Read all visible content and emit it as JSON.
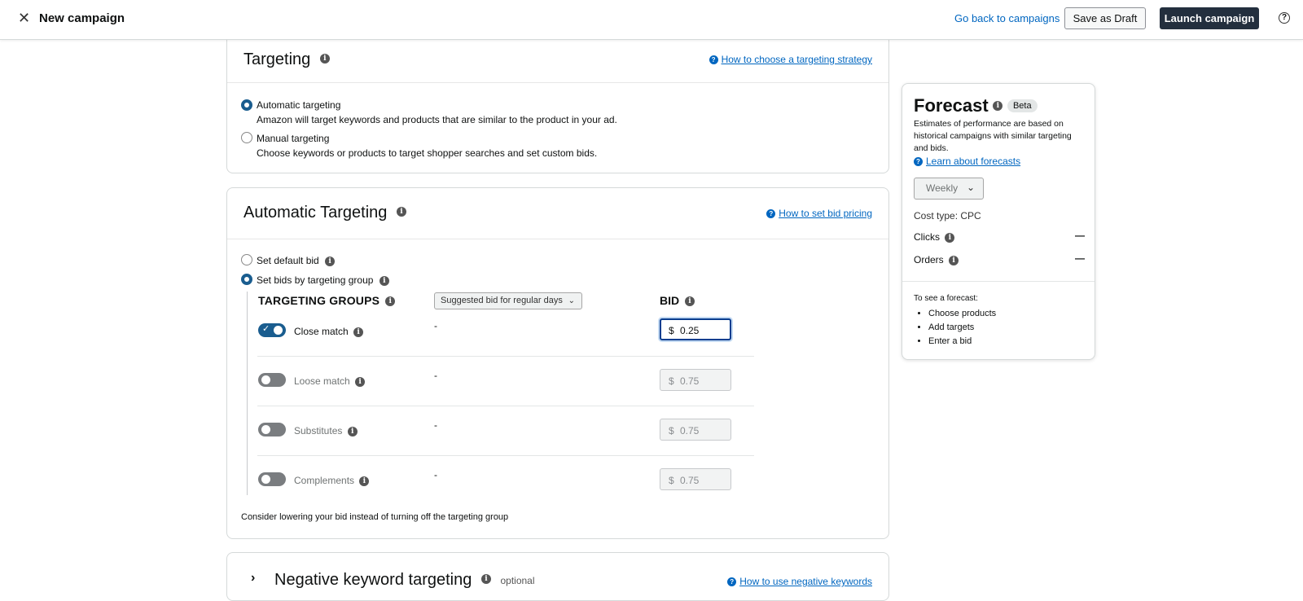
{
  "topbar": {
    "title": "New campaign",
    "back_link": "Go back to campaigns",
    "save_draft": "Save as Draft",
    "launch": "Launch campaign",
    "close_glyph": "✕",
    "help_glyph": "?"
  },
  "targeting": {
    "heading": "Targeting",
    "help_link": "How to choose a targeting strategy",
    "options": [
      {
        "label": "Automatic targeting",
        "desc": "Amazon will target keywords and products that are similar to the product in your ad.",
        "selected": true
      },
      {
        "label": "Manual targeting",
        "desc": "Choose keywords or products to target shopper searches and set custom bids.",
        "selected": false
      }
    ]
  },
  "auto": {
    "heading": "Automatic Targeting",
    "help_link": "How to set bid pricing",
    "default_bid_label": "Set default bid",
    "by_group_label": "Set bids by targeting group",
    "col_groups": "TARGETING GROUPS",
    "suggested_dropdown": "Suggested bid for regular days",
    "col_bid": "BID",
    "groups": [
      {
        "name": "Close match",
        "enabled": true,
        "suggested": "-",
        "currency": "$",
        "bid": "0.25"
      },
      {
        "name": "Loose match",
        "enabled": false,
        "suggested": "-",
        "currency": "$",
        "bid": "0.75"
      },
      {
        "name": "Substitutes",
        "enabled": false,
        "suggested": "-",
        "currency": "$",
        "bid": "0.75"
      },
      {
        "name": "Complements",
        "enabled": false,
        "suggested": "-",
        "currency": "$",
        "bid": "0.75"
      }
    ],
    "footer_note": "Consider lowering your bid instead of turning off the targeting group"
  },
  "negative": {
    "heading": "Negative keyword targeting",
    "optional": "optional",
    "help_link": "How to use negative keywords"
  },
  "forecast": {
    "title": "Forecast",
    "badge": "Beta",
    "desc": "Estimates of performance are based on historical campaigns with similar targeting and bids.",
    "learn_link": "Learn about forecasts",
    "period": "Weekly",
    "cost_type": "Cost type: CPC",
    "metrics": [
      {
        "label": "Clicks",
        "value": "—"
      },
      {
        "label": "Orders",
        "value": "—"
      }
    ],
    "steps_title": "To see a forecast:",
    "steps": [
      "Choose products",
      "Add targets",
      "Enter a bid"
    ]
  }
}
